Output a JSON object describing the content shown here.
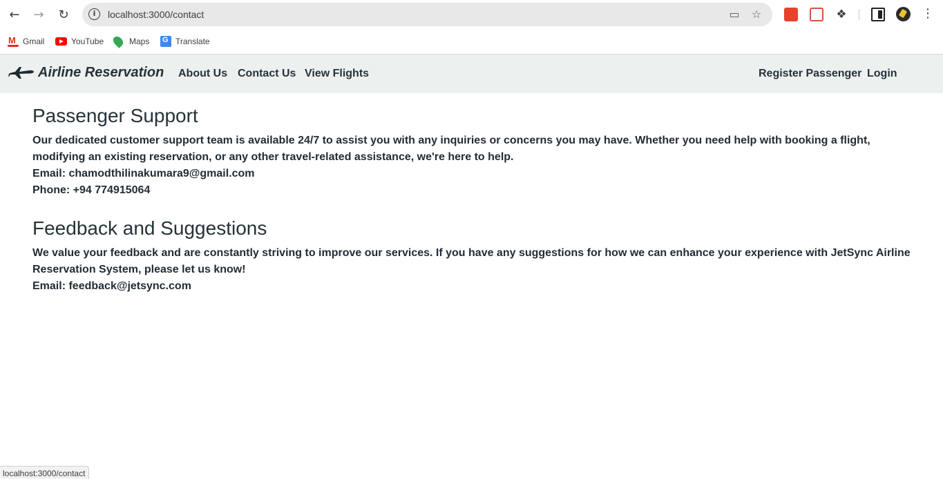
{
  "browser": {
    "url": "localhost:3000/contact",
    "bookmarks": [
      {
        "label": "Gmail",
        "icon": "gmail-icon"
      },
      {
        "label": "YouTube",
        "icon": "youtube-icon"
      },
      {
        "label": "Maps",
        "icon": "maps-icon"
      },
      {
        "label": "Translate",
        "icon": "translate-icon"
      }
    ],
    "status_text": "localhost:3000/contact"
  },
  "navbar": {
    "brand": "Airline Reservation",
    "links": {
      "about": "About Us",
      "contact": "Contact Us",
      "flights": "View Flights",
      "register": "Register Passenger",
      "login": "Login"
    }
  },
  "support": {
    "heading": "Passenger Support",
    "body": "Our dedicated customer support team is available 24/7 to assist you with any inquiries or concerns you may have. Whether you need help with booking a flight, modifying an existing reservation, or any other travel-related assistance, we're here to help.",
    "email_label": "Email:",
    "email": "chamodthilinakumara9@gmail.com",
    "phone_label": "Phone:",
    "phone": "+94 774915064"
  },
  "feedback": {
    "heading": "Feedback and Suggestions",
    "body": "We value your feedback and are constantly striving to improve our services. If you have any suggestions for how we can enhance your experience with JetSync Airline Reservation System, please let us know!",
    "email_label": "Email:",
    "email": "feedback@jetsync.com"
  },
  "colors": {
    "navbar_bg": "#ecf1f0",
    "text": "#222c35",
    "omnibox_bg": "#e8e8e8"
  }
}
